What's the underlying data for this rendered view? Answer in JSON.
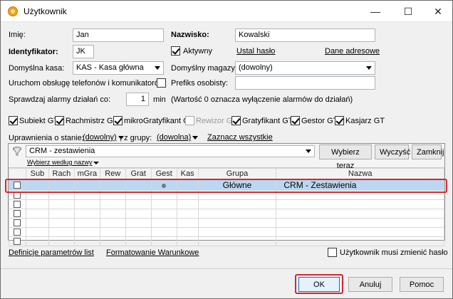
{
  "window": {
    "title": "Użytkownik",
    "controls": {
      "minimize": "—",
      "maximize": "☐",
      "close": "✕"
    }
  },
  "form": {
    "imie_label": "Imię:",
    "imie_value": "Jan",
    "nazwisko_label": "Nazwisko:",
    "nazwisko_value": "Kowalski",
    "identyfikator_label": "Identyfikator:",
    "identyfikator_value": "JK",
    "aktywny_label": "Aktywny",
    "ustal_haslo_link": "Ustal hasło",
    "dane_adresowe_link": "Dane adresowe",
    "kasa_label": "Domyślna kasa:",
    "kasa_value": "KAS - Kasa główna",
    "magazyn_label": "Domyślny magazyn:",
    "magazyn_value": "(dowolny)",
    "telefony_label": "Uruchom obsługę telefonów i komunikatorów",
    "prefiks_label": "Prefiks osobisty:",
    "prefiks_value": "",
    "alarmy_label": "Sprawdzaj alarmy działań co:",
    "alarmy_value": "1",
    "alarmy_unit": "min",
    "alarmy_note": "(Wartość 0 oznacza wyłączenie alarmów do działań)"
  },
  "modules": [
    {
      "label": "Subiekt GT",
      "checked": true,
      "disabled": false
    },
    {
      "label": "Rachmistrz GT",
      "checked": true,
      "disabled": false
    },
    {
      "label": "mikroGratyfikant GT",
      "checked": true,
      "disabled": false
    },
    {
      "label": "Rewizor GT",
      "checked": false,
      "disabled": true
    },
    {
      "label": "Gratyfikant GT",
      "checked": true,
      "disabled": false
    },
    {
      "label": "Gestor GT",
      "checked": true,
      "disabled": false
    },
    {
      "label": "Kasjarz GT",
      "checked": true,
      "disabled": false
    }
  ],
  "permissions": {
    "stan_label": "Uprawnienia o stanie:",
    "stan_value": "(dowolny)",
    "grupa_label": ", z grupy:",
    "grupa_value": "(dowolna)",
    "zaznacz_link": "Zaznacz wszystkie",
    "search_value": "CRM - zestawienia",
    "sort_label": "Wybierz według nazwy",
    "wybierz_button": "Wybierz teraz",
    "wyczysc_button": "Wyczyść",
    "zamknij_button": "Zamknij"
  },
  "grid": {
    "columns": [
      "",
      "Sub",
      "Rach",
      "mGra",
      "Rew",
      "Grat",
      "Gest",
      "Kas",
      "Grupa",
      "Nazwa"
    ],
    "rows": [
      {
        "grupa": "Główne",
        "nazwa": "CRM - Zestawienia",
        "gest_dot": true
      }
    ],
    "empty_rows": 6
  },
  "footer": {
    "definicje_link": "Definicje parametrów list",
    "formatowanie_link": "Formatowanie Warunkowe",
    "musi_zmienic_label": "Użytkownik musi zmienić hasło",
    "ok_button": "OK",
    "anuluj_button": "Anuluj",
    "pomoc_button": "Pomoc"
  },
  "colors": {
    "highlight": "#d8262e",
    "selection": "#bcd7f1"
  }
}
